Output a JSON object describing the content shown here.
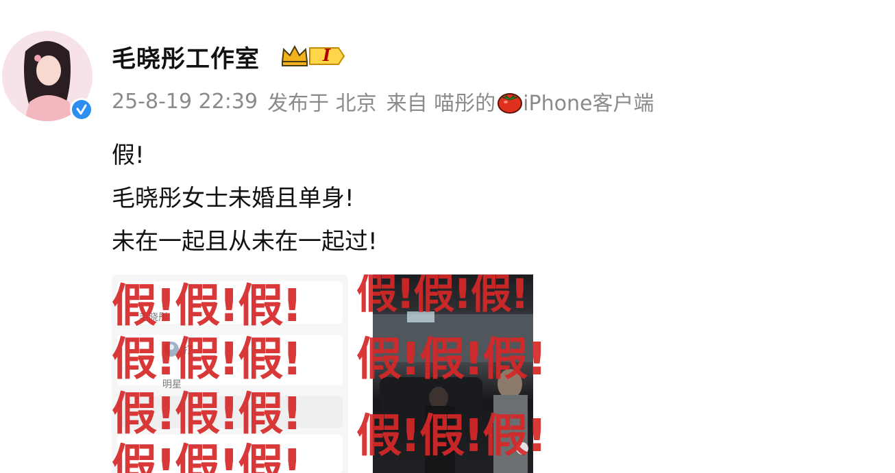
{
  "author": {
    "name": "毛晓彤工作室",
    "verified_icon": "verified-check-icon",
    "member_badge_icon": "crown-icon",
    "member_badge_level": "I"
  },
  "meta": {
    "timestamp": "25-8-19 22:39",
    "published_in": "发布于 北京",
    "source_prefix": "来自 喵彤的",
    "source_icon": "tomato-icon",
    "source_suffix": "iPhone客户端"
  },
  "post": {
    "lines": [
      "假!",
      "毛晓彤女士未婚且单身!",
      "未在一起且从未在一起过!"
    ]
  },
  "images": [
    {
      "watermark": "假!假!假!",
      "ghost_texts": [
        "毛晓彤",
        "打",
        "明星"
      ]
    },
    {
      "watermark": "假!假!假!"
    }
  ],
  "colors": {
    "watermark": "#d62828",
    "verified": "#2c8ff0",
    "meta_text": "#8a8a8a",
    "name_text": "#111111"
  }
}
